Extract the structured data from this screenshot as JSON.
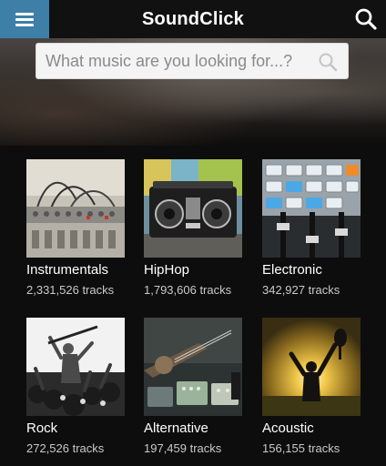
{
  "app": {
    "title": "SoundClick"
  },
  "header": {
    "menu_icon": "hamburger-menu-icon",
    "search_icon": "search-icon",
    "menu_color": "#3d7fa6"
  },
  "search": {
    "placeholder": "What music are you looking for...?",
    "value": "",
    "icon": "search-icon"
  },
  "genres": [
    {
      "name": "Instrumentals",
      "tracks": "2,331,526 tracks",
      "image": "mixing-console-photo"
    },
    {
      "name": "HipHop",
      "tracks": "1,793,606 tracks",
      "image": "boombox-photo"
    },
    {
      "name": "Electronic",
      "tracks": "342,927 tracks",
      "image": "mixer-buttons-photo"
    },
    {
      "name": "Rock",
      "tracks": "272,526 tracks",
      "image": "rock-concert-photo"
    },
    {
      "name": "Alternative",
      "tracks": "197,459 tracks",
      "image": "guitar-pedals-photo"
    },
    {
      "name": "Acoustic",
      "tracks": "156,155 tracks",
      "image": "guitar-sunset-photo"
    }
  ]
}
